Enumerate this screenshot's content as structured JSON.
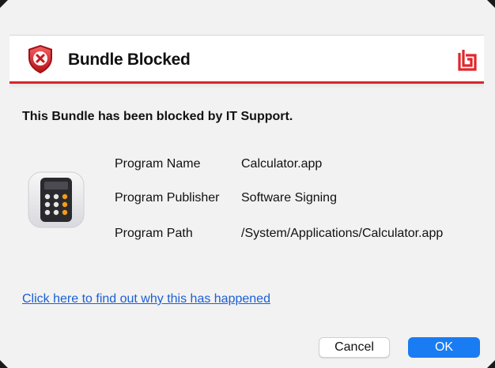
{
  "dialog": {
    "title": "Bundle Blocked",
    "headline": "This Bundle has been blocked by IT Support.",
    "details": [
      {
        "label": "Program Name",
        "value": "Calculator.app"
      },
      {
        "label": "Program Publisher",
        "value": "Software Signing"
      },
      {
        "label": "Program Path",
        "value": "/System/Applications/Calculator.app"
      }
    ],
    "help_link": "Click here to find out why this has happened",
    "buttons": {
      "cancel": "Cancel",
      "ok": "OK"
    },
    "icons": {
      "title": "blocked-shield-icon",
      "brand": "vendor-logo-icon",
      "app": "calculator-app-icon"
    },
    "colors": {
      "accent_line": "#d8262b",
      "link": "#1a5fd6",
      "ok_button": "#1a7cf2"
    }
  }
}
